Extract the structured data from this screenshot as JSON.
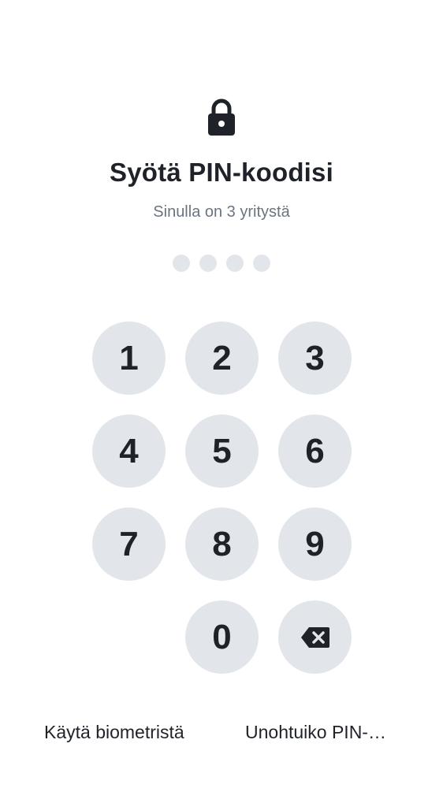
{
  "header": {
    "lock_icon": "lock-icon",
    "title": "Syötä PIN-koodisi",
    "subtitle": "Sinulla on 3 yritystä"
  },
  "pin": {
    "length": 4,
    "entered": 0
  },
  "keypad": {
    "keys": [
      "1",
      "2",
      "3",
      "4",
      "5",
      "6",
      "7",
      "8",
      "9",
      "0"
    ],
    "backspace_icon": "backspace-icon"
  },
  "footer": {
    "biometric_label": "Käytä biometristä",
    "forgot_label": "Unohtuiko PIN-…"
  },
  "colors": {
    "key_background": "#e2e6eb",
    "text": "#1f2329",
    "subtitle": "#6b7580"
  }
}
